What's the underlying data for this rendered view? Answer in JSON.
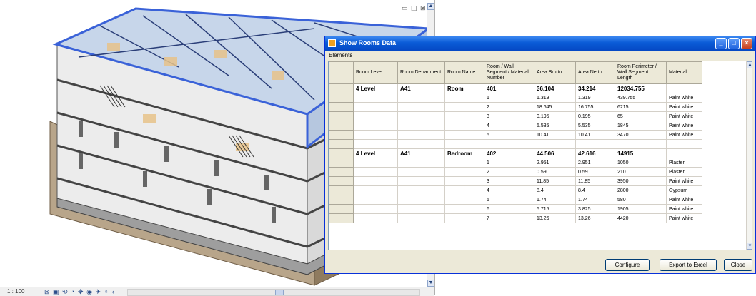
{
  "viewport": {
    "scale": "1 : 100",
    "view_controls": "▭ ◫ ⊠",
    "toolbar_glyphs": "⊠ ▣ ⟲ ◔ ✥ ◉ ✈ ♀ ‹"
  },
  "dialog": {
    "title": "Show Rooms Data",
    "menu": [
      "Elements"
    ],
    "columns": [
      "",
      "Room Level",
      "Room Department",
      "Room Name",
      "Room / Wall Segment / Material Number",
      "Area Brutto",
      "Area Netto",
      "Room Perimeter / Wall Segment Length",
      "Material"
    ],
    "rows": [
      {
        "main": true,
        "cells": [
          "4 Level",
          "A41",
          "Room",
          "401",
          "36.104",
          "34.214",
          "12034.755",
          ""
        ]
      },
      {
        "main": false,
        "cells": [
          "",
          "",
          "",
          "1",
          "1.319",
          "1.319",
          "439.755",
          "Paint white"
        ]
      },
      {
        "main": false,
        "cells": [
          "",
          "",
          "",
          "2",
          "18.645",
          "16.755",
          "6215",
          "Paint white"
        ]
      },
      {
        "main": false,
        "cells": [
          "",
          "",
          "",
          "3",
          "0.195",
          "0.195",
          "65",
          "Paint white"
        ]
      },
      {
        "main": false,
        "cells": [
          "",
          "",
          "",
          "4",
          "5.535",
          "5.535",
          "1845",
          "Paint white"
        ]
      },
      {
        "main": false,
        "cells": [
          "",
          "",
          "",
          "5",
          "10.41",
          "10.41",
          "3470",
          "Paint white"
        ]
      },
      {
        "main": false,
        "cells": [
          "",
          "",
          "",
          "",
          "",
          "",
          "",
          ""
        ]
      },
      {
        "main": true,
        "cells": [
          "4 Level",
          "A41",
          "Bedroom",
          "402",
          "44.506",
          "42.616",
          "14915",
          ""
        ]
      },
      {
        "main": false,
        "cells": [
          "",
          "",
          "",
          "1",
          "2.951",
          "2.951",
          "1050",
          "Plaster"
        ]
      },
      {
        "main": false,
        "cells": [
          "",
          "",
          "",
          "2",
          "0.59",
          "0.59",
          "210",
          "Plaster"
        ]
      },
      {
        "main": false,
        "cells": [
          "",
          "",
          "",
          "3",
          "11.85",
          "11.85",
          "3950",
          "Paint white"
        ]
      },
      {
        "main": false,
        "cells": [
          "",
          "",
          "",
          "4",
          "8.4",
          "8.4",
          "2800",
          "Gypsum"
        ]
      },
      {
        "main": false,
        "cells": [
          "",
          "",
          "",
          "5",
          "1.74",
          "1.74",
          "580",
          "Paint white"
        ]
      },
      {
        "main": false,
        "cells": [
          "",
          "",
          "",
          "6",
          "5.715",
          "3.825",
          "1905",
          "Paint white"
        ]
      },
      {
        "main": false,
        "cells": [
          "",
          "",
          "",
          "7",
          "13.26",
          "13.26",
          "4420",
          "Paint white"
        ]
      }
    ],
    "buttons": {
      "configure": "Configure",
      "export": "Export to Excel",
      "close": "Close"
    }
  },
  "colors": {
    "titlebar": "#0a5bd6",
    "dialog_bg": "#ece9d8",
    "building_outline": "#3a62d8"
  }
}
